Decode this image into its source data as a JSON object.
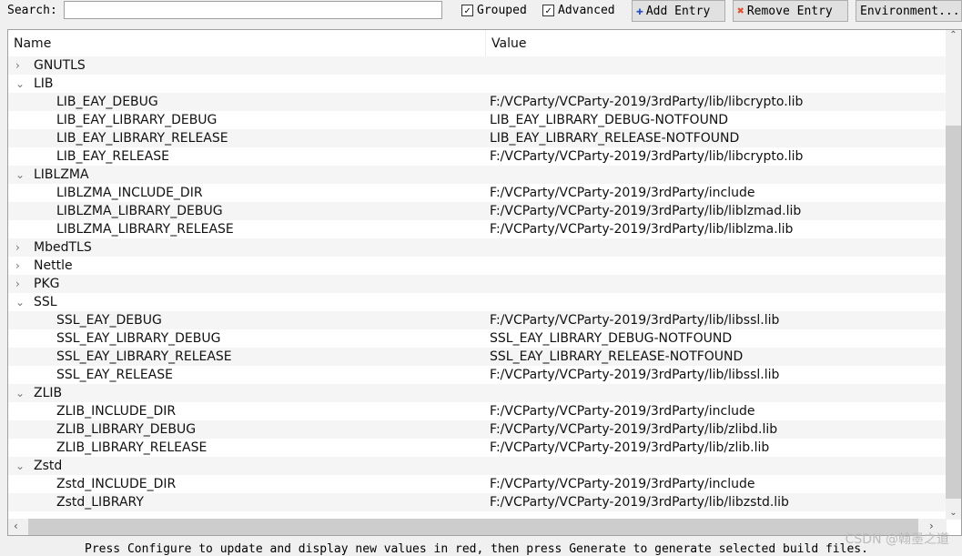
{
  "toolbar": {
    "search_label": "Search:",
    "search_value": "",
    "grouped_label": "Grouped",
    "grouped_checked": true,
    "advanced_label": "Advanced",
    "advanced_checked": true,
    "add_entry": "Add Entry",
    "remove_entry": "Remove Entry",
    "environment": "Environment..."
  },
  "tree": {
    "columns": [
      "Name",
      "Value"
    ],
    "rows": [
      {
        "level": 0,
        "expanded": false,
        "name": "GNUTLS",
        "value": ""
      },
      {
        "level": 0,
        "expanded": true,
        "name": "LIB",
        "value": ""
      },
      {
        "level": 1,
        "name": "LIB_EAY_DEBUG",
        "value": "F:/VCParty/VCParty-2019/3rdParty/lib/libcrypto.lib"
      },
      {
        "level": 1,
        "name": "LIB_EAY_LIBRARY_DEBUG",
        "value": "LIB_EAY_LIBRARY_DEBUG-NOTFOUND"
      },
      {
        "level": 1,
        "name": "LIB_EAY_LIBRARY_RELEASE",
        "value": "LIB_EAY_LIBRARY_RELEASE-NOTFOUND"
      },
      {
        "level": 1,
        "name": "LIB_EAY_RELEASE",
        "value": "F:/VCParty/VCParty-2019/3rdParty/lib/libcrypto.lib"
      },
      {
        "level": 0,
        "expanded": true,
        "name": "LIBLZMA",
        "value": ""
      },
      {
        "level": 1,
        "name": "LIBLZMA_INCLUDE_DIR",
        "value": "F:/VCParty/VCParty-2019/3rdParty/include"
      },
      {
        "level": 1,
        "name": "LIBLZMA_LIBRARY_DEBUG",
        "value": "F:/VCParty/VCParty-2019/3rdParty/lib/liblzmad.lib"
      },
      {
        "level": 1,
        "name": "LIBLZMA_LIBRARY_RELEASE",
        "value": "F:/VCParty/VCParty-2019/3rdParty/lib/liblzma.lib"
      },
      {
        "level": 0,
        "expanded": false,
        "name": "MbedTLS",
        "value": ""
      },
      {
        "level": 0,
        "expanded": false,
        "name": "Nettle",
        "value": ""
      },
      {
        "level": 0,
        "expanded": false,
        "name": "PKG",
        "value": ""
      },
      {
        "level": 0,
        "expanded": true,
        "name": "SSL",
        "value": ""
      },
      {
        "level": 1,
        "name": "SSL_EAY_DEBUG",
        "value": "F:/VCParty/VCParty-2019/3rdParty/lib/libssl.lib"
      },
      {
        "level": 1,
        "name": "SSL_EAY_LIBRARY_DEBUG",
        "value": "SSL_EAY_LIBRARY_DEBUG-NOTFOUND"
      },
      {
        "level": 1,
        "name": "SSL_EAY_LIBRARY_RELEASE",
        "value": "SSL_EAY_LIBRARY_RELEASE-NOTFOUND"
      },
      {
        "level": 1,
        "name": "SSL_EAY_RELEASE",
        "value": "F:/VCParty/VCParty-2019/3rdParty/lib/libssl.lib"
      },
      {
        "level": 0,
        "expanded": true,
        "name": "ZLIB",
        "value": ""
      },
      {
        "level": 1,
        "name": "ZLIB_INCLUDE_DIR",
        "value": "F:/VCParty/VCParty-2019/3rdParty/include"
      },
      {
        "level": 1,
        "name": "ZLIB_LIBRARY_DEBUG",
        "value": "F:/VCParty/VCParty-2019/3rdParty/lib/zlibd.lib"
      },
      {
        "level": 1,
        "name": "ZLIB_LIBRARY_RELEASE",
        "value": "F:/VCParty/VCParty-2019/3rdParty/lib/zlib.lib"
      },
      {
        "level": 0,
        "expanded": true,
        "name": "Zstd",
        "value": ""
      },
      {
        "level": 1,
        "name": "Zstd_INCLUDE_DIR",
        "value": "F:/VCParty/VCParty-2019/3rdParty/include"
      },
      {
        "level": 1,
        "name": "Zstd_LIBRARY",
        "value": "F:/VCParty/VCParty-2019/3rdParty/lib/libzstd.lib"
      }
    ]
  },
  "status": "Press Configure to update and display new values in red, then press Generate to generate selected build files.",
  "watermark": "CSDN @翰墨之道"
}
